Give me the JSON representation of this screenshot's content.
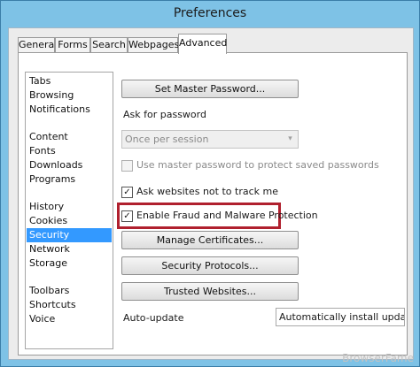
{
  "window": {
    "title": "Preferences"
  },
  "tabs": [
    {
      "label": "General",
      "active": false
    },
    {
      "label": "Forms",
      "active": false
    },
    {
      "label": "Search",
      "active": false
    },
    {
      "label": "Webpages",
      "active": false
    },
    {
      "label": "Advanced",
      "active": true
    }
  ],
  "sidebar": {
    "items": [
      {
        "label": "Tabs",
        "selected": false
      },
      {
        "label": "Browsing",
        "selected": false
      },
      {
        "label": "Notifications",
        "selected": false
      },
      {
        "label": "Content",
        "selected": false
      },
      {
        "label": "Fonts",
        "selected": false
      },
      {
        "label": "Downloads",
        "selected": false
      },
      {
        "label": "Programs",
        "selected": false
      },
      {
        "label": "History",
        "selected": false
      },
      {
        "label": "Cookies",
        "selected": false
      },
      {
        "label": "Security",
        "selected": true
      },
      {
        "label": "Network",
        "selected": false
      },
      {
        "label": "Storage",
        "selected": false
      },
      {
        "label": "Toolbars",
        "selected": false
      },
      {
        "label": "Shortcuts",
        "selected": false
      },
      {
        "label": "Voice",
        "selected": false
      }
    ]
  },
  "security": {
    "set_master_password_label": "Set Master Password...",
    "ask_for_password_label": "Ask for password",
    "ask_for_password_value": "Once per session",
    "use_master_password_label": "Use master password to protect saved passwords",
    "use_master_password_checked": false,
    "do_not_track_label": "Ask websites not to track me",
    "do_not_track_checked": true,
    "fraud_protection_label": "Enable Fraud and Malware Protection",
    "fraud_protection_checked": true,
    "manage_certificates_label": "Manage Certificates...",
    "security_protocols_label": "Security Protocols...",
    "trusted_websites_label": "Trusted Websites...",
    "auto_update_label": "Auto-update",
    "auto_update_value": "Automatically install updates"
  },
  "check_glyph": "✓",
  "dropdown_arrow_glyph": "▾",
  "watermark": "BrowserFame",
  "colors": {
    "titlebar": "#7ec2e6",
    "selection": "#3399ff",
    "highlight_box": "#b0202e"
  }
}
